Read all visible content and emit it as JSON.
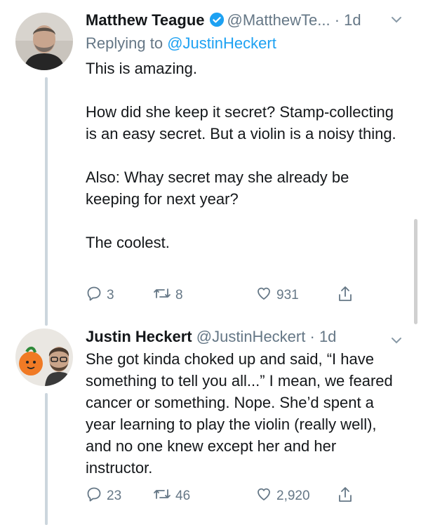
{
  "tweets": [
    {
      "author": "Matthew Teague",
      "handle": "@MatthewTe...",
      "separator": "·",
      "time": "1d",
      "verified": true,
      "replying_prefix": "Replying to",
      "replying_to": "@JustinHeckert",
      "paragraphs": [
        "This is amazing.",
        "How did she keep it secret? Stamp-collecting is an easy secret. But a violin is a noisy thing.",
        "Also: Whay secret may she already be keeping for next year?",
        "The coolest."
      ],
      "replies": "3",
      "retweets": "8",
      "likes": "931"
    },
    {
      "author": "Justin Heckert",
      "handle": "@JustinHeckert",
      "separator": "·",
      "time": "1d",
      "verified": false,
      "paragraphs": [
        "She got kinda choked up and said, “I have something to tell you all...” I mean, we feared cancer or something. Nope. She’d spent a year learning to play the violin (really well), and no one knew except her and her instructor."
      ],
      "replies": "23",
      "retweets": "46",
      "likes": "2,920"
    }
  ],
  "colors": {
    "text": "#14171a",
    "secondary": "#657786",
    "accent": "#1da1f2",
    "thread_line": "#ccd6dd"
  },
  "icons": [
    "verified-icon",
    "chevron-down-icon",
    "reply-icon",
    "retweet-icon",
    "like-icon",
    "share-icon"
  ]
}
